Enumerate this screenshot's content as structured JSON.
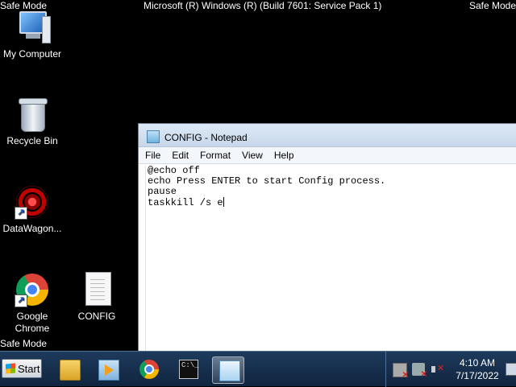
{
  "desktop": {
    "safe_mode_label": "Safe Mode",
    "build_text": "Microsoft (R) Windows (R) (Build 7601: Service Pack 1)",
    "icons": [
      {
        "label": "My Computer",
        "icon": "computer-icon"
      },
      {
        "label": "Recycle Bin",
        "icon": "recycle-bin-icon"
      },
      {
        "label": "DataWagon...",
        "icon": "datawagon-icon"
      },
      {
        "label": "Google Chrome",
        "icon": "chrome-icon"
      },
      {
        "label": "CONFIG",
        "icon": "text-file-icon"
      }
    ]
  },
  "notepad": {
    "title": "CONFIG - Notepad",
    "menu": [
      "File",
      "Edit",
      "Format",
      "View",
      "Help"
    ],
    "content": "@echo off\necho Press ENTER to start Config process.\npause\ntaskkill /s e"
  },
  "taskbar": {
    "start_label": "Start",
    "pinned": [
      "explorer-icon",
      "media-player-icon",
      "chrome-icon",
      "command-prompt-icon",
      "notepad-icon"
    ],
    "active": "notepad-icon",
    "time": "4:10 AM",
    "date": "7/17/2022"
  }
}
